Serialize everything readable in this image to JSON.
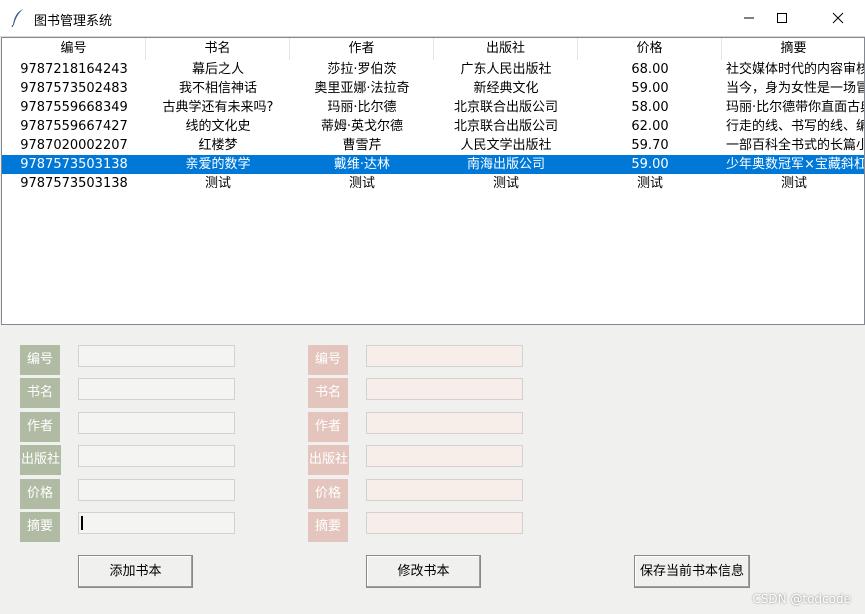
{
  "window": {
    "title": "图书管理系统",
    "icon": "feather-icon",
    "controls": [
      "minimize-icon",
      "maximize-icon",
      "close-icon"
    ]
  },
  "table": {
    "columns": [
      "编号",
      "书名",
      "作者",
      "出版社",
      "价格",
      "摘要"
    ],
    "rows": [
      [
        "9787218164243",
        "幕后之人",
        "莎拉·罗伯茨",
        "广东人民出版社",
        "68.00",
        "社交媒体时代的内容审核"
      ],
      [
        "9787573502483",
        "我不相信神话",
        "奥里亚娜·法拉奇",
        "新经典文化",
        "59.00",
        "当今，身为女性是一场冒险"
      ],
      [
        "9787559668349",
        "古典学还有未来吗?",
        "玛丽·比尔德",
        "北京联合出版公司",
        "58.00",
        "玛丽·比尔德带你直面古典"
      ],
      [
        "9787559667427",
        "线的文化史",
        "蒂姆·英戈尔德",
        "北京联合出版公司",
        "62.00",
        "行走的线、书写的线、编织"
      ],
      [
        "9787020002207",
        "红楼梦",
        "曹雪芹",
        "人民文学出版社",
        "59.70",
        "一部百科全书式的长篇小说"
      ],
      [
        "9787573503138",
        "亲爱的数学",
        "戴维·达林",
        "南海出版公司",
        "59.00",
        "少年奥数冠军×宝藏斜杠"
      ],
      [
        "9787573503138",
        "测试",
        "测试",
        "测试",
        "测试",
        "测试"
      ]
    ],
    "selected_row": 5
  },
  "form_left": {
    "labels": [
      "编号",
      "书名",
      "作者",
      "出版社",
      "价格",
      "摘要"
    ],
    "values": [
      "",
      "",
      "",
      "",
      "",
      ""
    ]
  },
  "form_right": {
    "labels": [
      "编号",
      "书名",
      "作者",
      "出版社",
      "价格",
      "摘要"
    ],
    "values": [
      "",
      "",
      "",
      "",
      "",
      ""
    ]
  },
  "buttons": {
    "add": "添加书本",
    "modify": "修改书本",
    "save": "保存当前书本信息"
  },
  "watermark": "CSDN @todcode",
  "colors": {
    "left_label_bg": "#b1bba4",
    "right_label_bg": "#e4c5bd",
    "selection": "#0078d7"
  }
}
